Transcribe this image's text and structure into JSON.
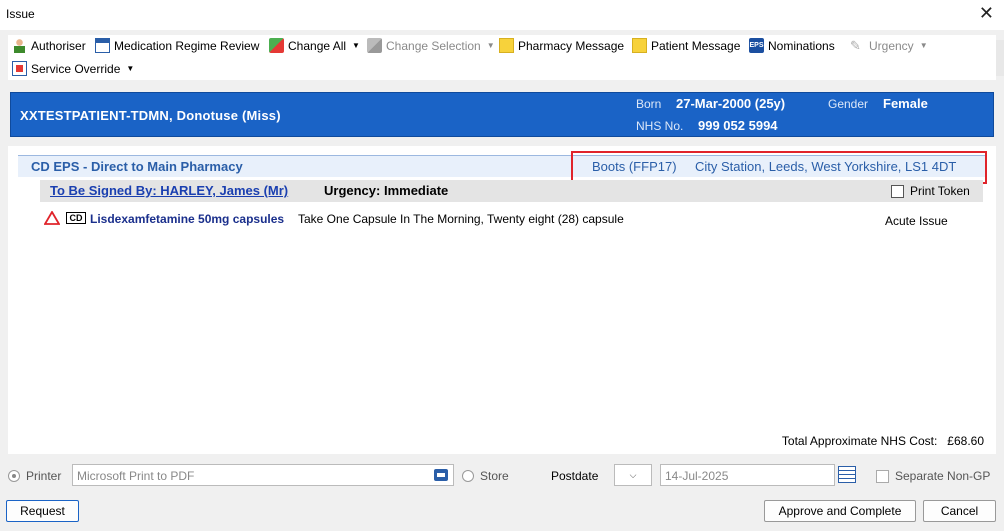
{
  "window": {
    "title": "Issue",
    "close_glyph": "✕"
  },
  "toolbar": {
    "items": [
      {
        "label": "Authoriser",
        "icon": "person-icon"
      },
      {
        "label": "Medication Regime Review",
        "icon": "calendar-icon"
      },
      {
        "label": "Change All",
        "icon": "change-icon"
      },
      {
        "label": "Change Selection",
        "icon": "change-icon"
      },
      {
        "label": "Pharmacy Message",
        "icon": "note-icon"
      },
      {
        "label": "Patient Message",
        "icon": "note-icon"
      },
      {
        "label": "Nominations",
        "icon": "eps-icon"
      },
      {
        "label": "Urgency",
        "icon": "feather-icon"
      },
      {
        "label": "Service Override",
        "icon": "override-icon"
      }
    ],
    "eps_icon_text": "EPS"
  },
  "patient": {
    "name": "XXTESTPATIENT-TDMN,  Donotuse  (Miss)",
    "born_label": "Born",
    "born_value": "27-Mar-2000 (25y)",
    "gender_label": "Gender",
    "gender_value": "Female",
    "nhs_label": "NHS No.",
    "nhs_value": "999 052 5994"
  },
  "prescription": {
    "route": "CD EPS - Direct to Main Pharmacy",
    "pharmacy": "Boots (FFP17)",
    "address": "City Station, Leeds, West Yorkshire, LS1 4DT",
    "signed_by": "To Be Signed By: HARLEY, James (Mr)",
    "urgency": "Urgency: Immediate",
    "print_token_label": "Print Token",
    "print_token_checked": false
  },
  "medications": [
    {
      "cd_badge": "CD",
      "name": "Lisdexamfetamine 50mg capsules",
      "dosage": "Take One Capsule In The Morning, Twenty eight (28) capsule",
      "issue_type": "Acute Issue"
    }
  ],
  "totals": {
    "label": "Total Approximate NHS Cost:",
    "value": "£68.60"
  },
  "options": {
    "printer_label": "Printer",
    "printer_value": "Microsoft Print to PDF",
    "store_label": "Store",
    "postdate_label": "Postdate",
    "postdate_value": "14-Jul-2025",
    "separate_label": "Separate Non-GP",
    "dropdown_glyph": "⌵"
  },
  "buttons": {
    "request": "Request",
    "approve": "Approve and Complete",
    "cancel": "Cancel"
  },
  "colors": {
    "banner": "#1a63c6",
    "link": "#1a3fb0",
    "highlight": "#e0242b"
  }
}
